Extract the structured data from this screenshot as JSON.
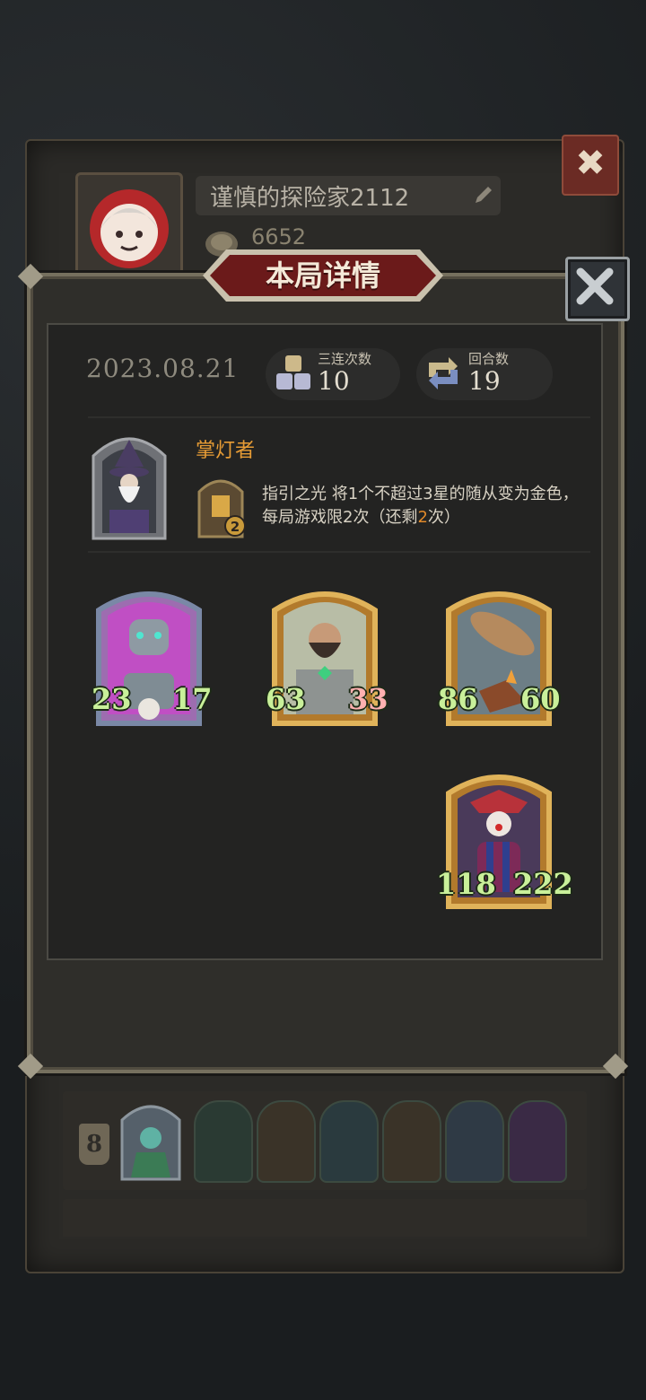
{
  "profile": {
    "player_name": "谨慎的探险家2112",
    "coins": "6652"
  },
  "modal": {
    "title": "本局详情",
    "date": "2023.08.21",
    "triple_count": {
      "label": "三连次数",
      "value": "10"
    },
    "rounds": {
      "label": "回合数",
      "value": "19"
    }
  },
  "hero": {
    "name": "掌灯者",
    "skill_charges": "2",
    "skill_name": "指引之光",
    "skill_desc_a": " 将1个不超过3星的随从变为金色，每局游戏限2次（还剩",
    "skill_remaining": "2",
    "skill_desc_b": "次）"
  },
  "minions": [
    {
      "attack": "23",
      "health": "17",
      "frame": "purple",
      "icon": "robot-minion-icon"
    },
    {
      "attack": "63",
      "health": "33",
      "frame": "gold",
      "icon": "bearded-warrior-minion-icon"
    },
    {
      "attack": "86",
      "health": "60",
      "frame": "gold",
      "icon": "airship-minion-icon"
    },
    {
      "attack": "118",
      "health": "222",
      "frame": "gold",
      "icon": "jester-minion-icon"
    }
  ],
  "history": {
    "row1_rank": "8"
  },
  "colors": {
    "accent_orange": "#e79c35",
    "stat_green": "#c9f09a",
    "title_red": "#6b1a1a"
  }
}
